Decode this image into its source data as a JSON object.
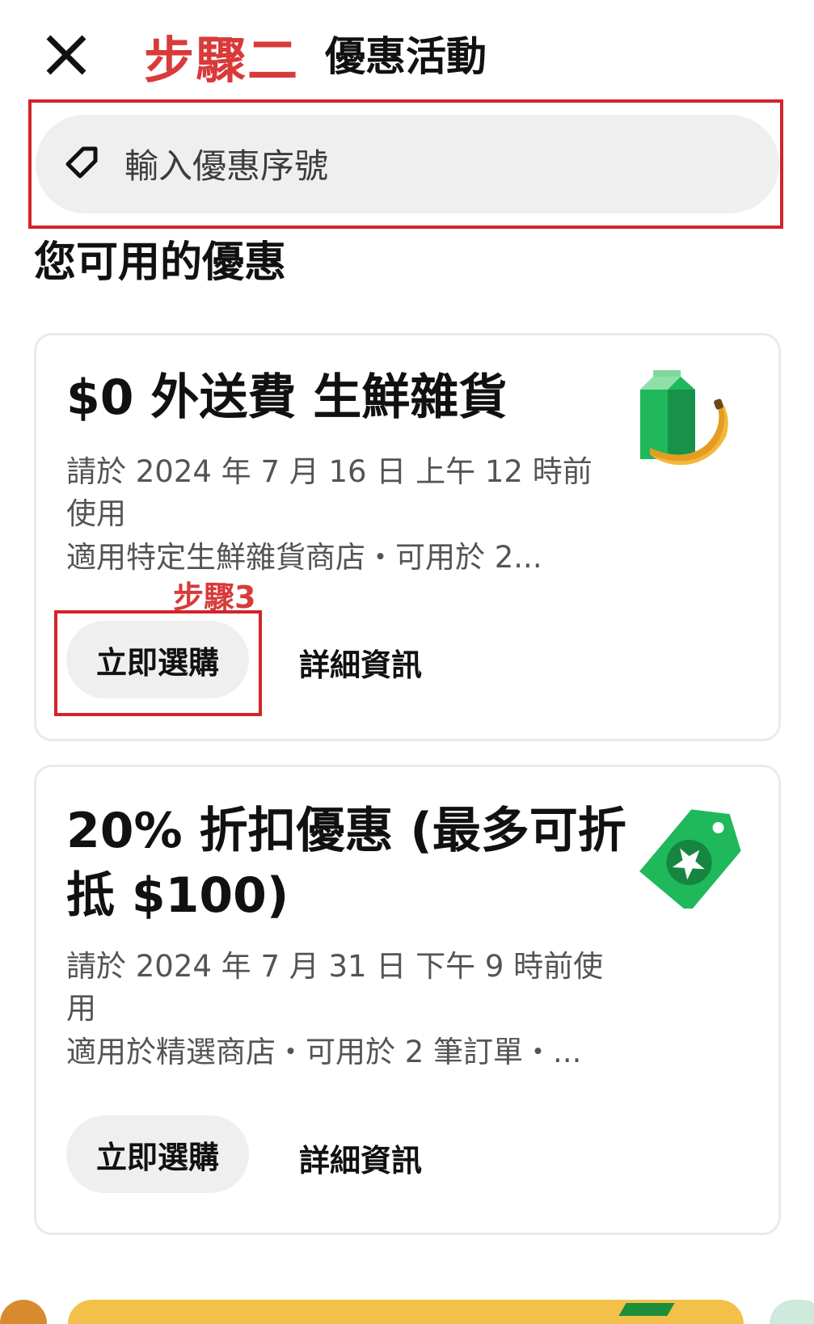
{
  "header": {
    "close_icon": "close-icon",
    "step_label": "步驟二",
    "title": "優惠活動"
  },
  "promo_input": {
    "icon": "tag-icon",
    "placeholder": "輸入優惠序號"
  },
  "section_heading": "您可用的優惠",
  "offers": [
    {
      "title": "$0 外送費 生鮮雜貨",
      "expiry": "請於 2024 年 7 月 16 日 上午 12 時前使用",
      "meta": "適用特定生鮮雜貨商店・可用於 2...",
      "shop_label": "立即選購",
      "details_label": "詳細資訊",
      "illustration": "grocery-milk-banana-icon"
    },
    {
      "title": "20% 折扣優惠 (最多可折抵 $100)",
      "expiry": "請於 2024 年 7 月 31 日 下午 9 時前使用",
      "meta": "適用於精選商店・可用於 2 筆訂單・...",
      "shop_label": "立即選購",
      "details_label": "詳細資訊",
      "illustration": "star-tag-icon"
    }
  ],
  "annotations": {
    "step3_label": "步驟3",
    "color": "#d2242a"
  },
  "colors": {
    "annotation_red": "#d2242a",
    "annotation_text_red": "#d93a3a",
    "brand_green": "#06c167",
    "button_gray": "#efefef"
  }
}
